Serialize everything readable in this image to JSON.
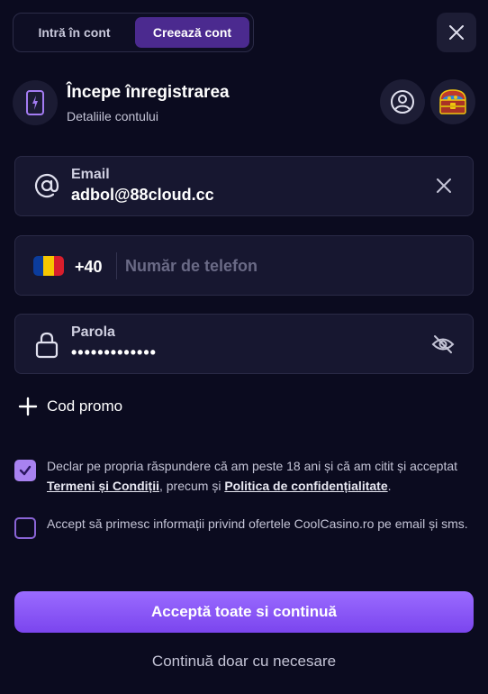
{
  "tabs": [
    {
      "label": "Intră în cont",
      "active": false
    },
    {
      "label": "Creează cont",
      "active": true
    }
  ],
  "header": {
    "title": "Începe înregistrarea",
    "subtitle": "Detaliile contului"
  },
  "email_field": {
    "label": "Email",
    "value": "adbol@88cloud.cc"
  },
  "phone_field": {
    "country_code": "+40",
    "placeholder": "Număr de telefon",
    "value": ""
  },
  "password_field": {
    "label": "Parola",
    "value": "•••••••••••••"
  },
  "promo": {
    "label": "Cod promo"
  },
  "consent_age": {
    "checked": true,
    "text_before": "Declar pe propria răspundere că am peste 18 ani și că am citit și acceptat ",
    "terms_link": "Termeni și Condiții",
    "text_middle": ", precum și ",
    "privacy_link": "Politica de confidențialitate",
    "text_after": "."
  },
  "consent_marketing": {
    "checked": false,
    "text": "Accept să primesc informații privind ofertele CoolCasino.ro pe email și sms."
  },
  "actions": {
    "accept_label": "Acceptă toate si continuă",
    "necessary_label": "Continuă doar cu necesare"
  },
  "colors": {
    "background": "#0b0b1f",
    "field_bg": "#171730",
    "accent": "#8b5cf6",
    "active_tab": "#4b2a8f"
  },
  "icons": {
    "close": "close-icon",
    "phone": "phone-lightning-icon",
    "user": "user-circle-icon",
    "chest": "treasure-chest-icon",
    "email": "at-icon",
    "clear": "clear-icon",
    "lock": "lock-icon",
    "visibility": "eye-off-icon",
    "plus": "plus-icon",
    "check": "checkmark-icon"
  }
}
